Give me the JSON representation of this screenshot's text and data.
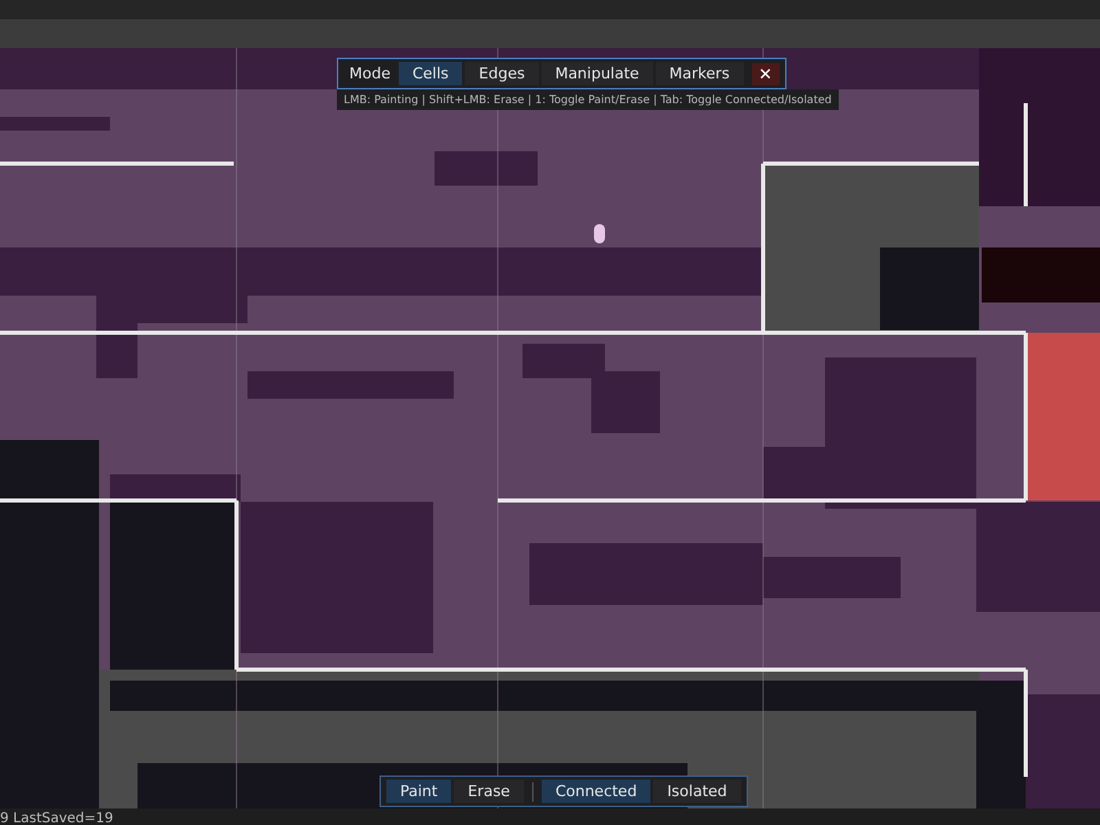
{
  "mode_toolbar": {
    "label": "Mode",
    "items": [
      {
        "label": "Cells",
        "selected": true
      },
      {
        "label": "Edges",
        "selected": false
      },
      {
        "label": "Manipulate",
        "selected": false
      },
      {
        "label": "Markers",
        "selected": false
      }
    ],
    "close": "✕"
  },
  "hint": "LMB: Painting | Shift+LMB: Erase | 1: Toggle Paint/Erase | Tab: Toggle Connected/Isolated",
  "brush_toolbar": {
    "tools": [
      {
        "label": "Paint",
        "selected": true
      },
      {
        "label": "Erase",
        "selected": false
      }
    ],
    "connectivity": [
      {
        "label": "Connected",
        "selected": true
      },
      {
        "label": "Isolated",
        "selected": false
      }
    ]
  },
  "status_bar": {
    "text": "9 LastSaved=19"
  }
}
